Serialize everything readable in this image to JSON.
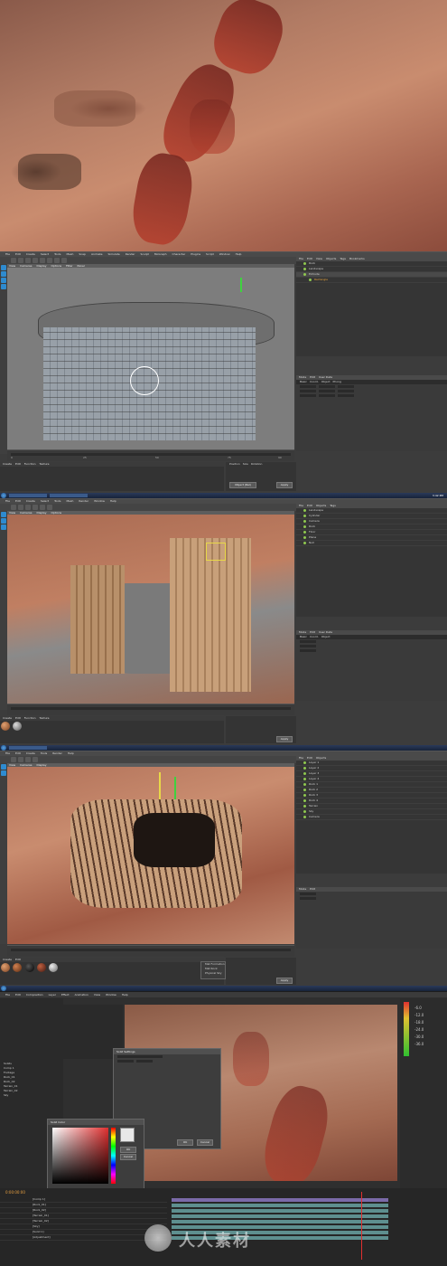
{
  "c4d": {
    "menu": [
      "File",
      "Edit",
      "Create",
      "Select",
      "Tools",
      "Mesh",
      "Snap",
      "Animate",
      "Simulate",
      "Render",
      "Sculpt",
      "MoGraph",
      "Character",
      "Plugins",
      "Script",
      "Window",
      "Help"
    ],
    "viewport_menu": [
      "View",
      "Cameras",
      "Display",
      "Options",
      "Filter",
      "Panel"
    ],
    "objmgr_tabs": [
      "Objects",
      "Takes",
      "Content Browser",
      "Structure"
    ],
    "objmgr_menu": [
      "File",
      "Edit",
      "View",
      "Objects",
      "Tags",
      "Bookmarks"
    ],
    "attr_tabs": [
      "Basic",
      "Coord.",
      "Object",
      "Phong"
    ],
    "attr_menu": [
      "Mode",
      "Edit",
      "User Data"
    ],
    "mat_menu": [
      "Create",
      "Edit",
      "Function",
      "Texture"
    ],
    "coord_labels": [
      "Position",
      "Size",
      "Rotation"
    ],
    "apply_label": "Apply",
    "object_rel_label": "Object (Rel)",
    "timeline_ticks": [
      "0",
      "5",
      "10",
      "15",
      "20",
      "25",
      "30",
      "35",
      "40",
      "45",
      "50",
      "55",
      "60",
      "65",
      "70",
      "75",
      "80",
      "85",
      "90"
    ],
    "frame_label": "0 F",
    "shot1_objects": [
      "Rock",
      "Landscape",
      "Extrude",
      "Rectangle"
    ],
    "shot2_objects": [
      "Landscape",
      "Cylinder",
      "Camera",
      "Rock",
      "Floor",
      "Plane",
      "Null"
    ],
    "shot3_objects": [
      "Layer 1",
      "Layer 2",
      "Layer 3",
      "Layer 4",
      "Rock 1",
      "Rock 2",
      "Rock 3",
      "Rock 4",
      "Terrain",
      "Sky",
      "Camera"
    ],
    "popup_items": [
      "Mat Formation",
      "Mat Rock",
      "Physical Sky"
    ],
    "clock": "3:42 PM"
  },
  "ae": {
    "menu": [
      "File",
      "Edit",
      "Composition",
      "Layer",
      "Effect",
      "Animation",
      "View",
      "Window",
      "Help"
    ],
    "project_items": [
      "Solids",
      "Comp 1",
      "Footage",
      "Rock_01",
      "Rock_02",
      "Terrain_01",
      "Terrain_02",
      "Sky"
    ],
    "dialog_title": "Solid Settings",
    "color_dialog_title": "Solid Color",
    "ok_label": "OK",
    "cancel_label": "Cancel",
    "layers": [
      "[Comp 1]",
      "[Rock_01]",
      "[Rock_02]",
      "[Terrain_01]",
      "[Terrain_02]",
      "[Sky]",
      "[Solid 1]",
      "[Adjustment]"
    ],
    "timecode": "0:00:00:00",
    "levels": [
      "-6.0",
      "-12.0",
      "-18.0",
      "-24.0",
      "-30.0",
      "-36.0"
    ],
    "watermark": "人人素材"
  }
}
